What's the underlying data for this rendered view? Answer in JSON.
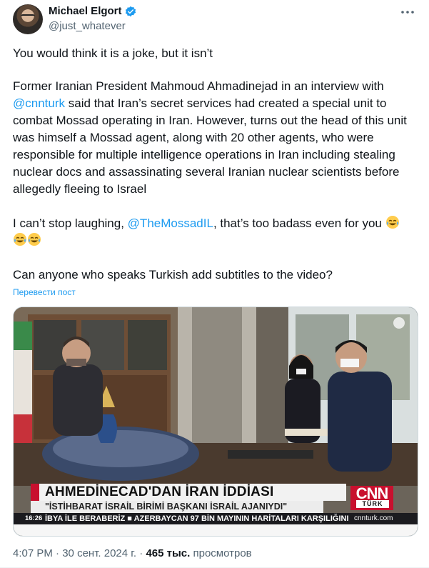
{
  "author": {
    "name": "Michael Elgort",
    "handle": "@just_whatever",
    "verified": true
  },
  "tweet": {
    "paragraphs": {
      "p1": "You would think it is a joke, but it isn’t",
      "p2_before": "Former Iranian President Mahmoud Ahmadinejad in an interview with ",
      "p2_mention": "@cnnturk",
      "p2_after": " said that Iran’s secret services had created a special unit to combat Mossad operating in Iran. However, turns out the head of this unit was himself a Mossad agent, along with 20 other agents, who were responsible for multiple intelligence operations in Iran including stealing nuclear docs and assassinating several Iranian nuclear scientists before allegedly fleeing to Israel",
      "p3_before": "I can’t stop laughing, ",
      "p3_mention": "@TheMossadIL",
      "p3_after": ", that’s too badass even for you ",
      "p4": "Can anyone who speaks Turkish add subtitles to the video?"
    },
    "emojis": [
      "face-with-tears-of-joy",
      "face-with-tears-of-joy",
      "face-with-tears-of-joy"
    ],
    "translate_label": "Перевести пост"
  },
  "media": {
    "headline": "AHMEDİNECAD'DAN İRAN İDDİASI",
    "subheadline": "\"İSTİHBARAT İSRAİL BİRİMİ BAŞKANI İSRAİL AJANIYDI\"",
    "logo_text": "CNN",
    "logo_subtext": "TÜRK",
    "ticker_time": "16:26",
    "ticker_text": "İBYA İLE BERABERİZ  ■  AZERBAYCAN 97 BİN MAYININ HARİTALARI KARŞILIĞINI",
    "ticker_site": "cnnturk.com"
  },
  "meta": {
    "time": "4:07 PM",
    "separator": "·",
    "date": "30 сент. 2024 г.",
    "views_count": "465 тыс.",
    "views_label": "просмотров"
  },
  "colors": {
    "link": "#1d9bf0",
    "secondary_text": "#536471",
    "cnn_red": "#c8102e",
    "verified": "#1d9bf0"
  }
}
